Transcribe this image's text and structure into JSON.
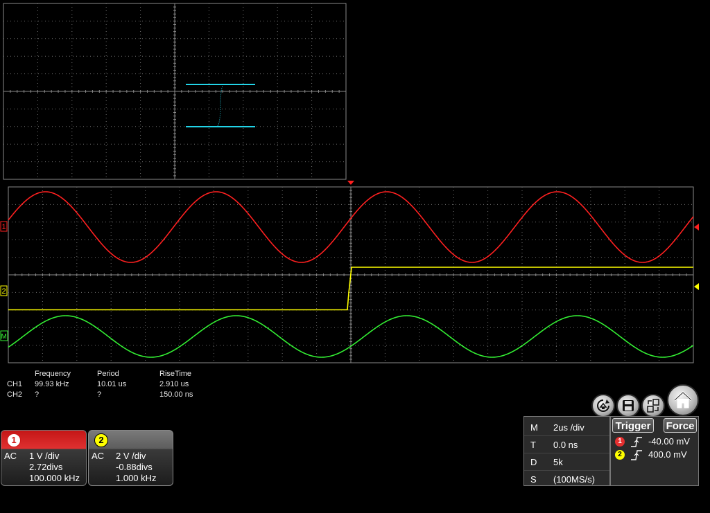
{
  "measurements": {
    "headers": [
      "Frequency",
      "Period",
      "RiseTime"
    ],
    "rows": [
      {
        "channel": "CH1",
        "values": [
          "99.93 kHz",
          "10.01 us",
          "2.910 us"
        ]
      },
      {
        "channel": "CH2",
        "values": [
          "?",
          "?",
          "150.00 ns"
        ]
      }
    ]
  },
  "channels": [
    {
      "number": "1",
      "coupling": "AC",
      "scale": "1 V /div",
      "offset": "2.72divs",
      "frequency": "100.000 kHz",
      "color": "#ff2020"
    },
    {
      "number": "2",
      "coupling": "AC",
      "scale": "2 V /div",
      "offset": "-0.88divs",
      "frequency": "1.000 kHz",
      "color": "#ffff00"
    }
  ],
  "trace_markers": {
    "ch1": "1",
    "ch2": "2",
    "math": "M"
  },
  "timebase": {
    "rows": [
      {
        "key": "M",
        "value": "2us /div"
      },
      {
        "key": "T",
        "value": "0.0 ns"
      },
      {
        "key": "D",
        "value": "5k"
      },
      {
        "key": "S",
        "value": "(100MS/s)"
      }
    ]
  },
  "trigger": {
    "trigger_label": "Trigger",
    "force_label": "Force",
    "levels": [
      {
        "channel": "1",
        "slope": "rising",
        "level": "-40.00 mV",
        "color": "#e53030"
      },
      {
        "channel": "2",
        "slope": "rising",
        "level": "400.0 mV",
        "color": "#ffff00"
      }
    ]
  },
  "toolbar": {
    "icons": [
      "autoset-icon",
      "save-icon",
      "display-layout-icon",
      "home-icon"
    ]
  },
  "trace_colors": {
    "ch1": "#ff2020",
    "ch2": "#ffff00",
    "math": "#33ee33",
    "xy": "#22d4e8"
  }
}
